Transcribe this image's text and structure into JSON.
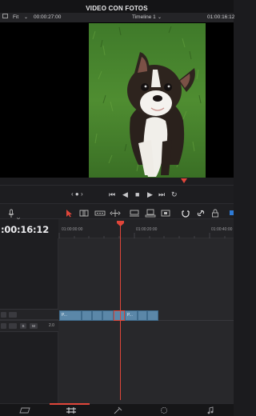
{
  "project": {
    "title": "VIDEO CON FOTOS"
  },
  "viewer": {
    "fit": "Fit",
    "duration": "00:00:27:00",
    "timeline_name": "Timeline 1",
    "source_tc": "01:00:16:12"
  },
  "transport": {
    "prev_next": "‹ ● ›",
    "first": "⏮",
    "reverse": "◀",
    "stop": "■",
    "play": "▶",
    "last": "⏭",
    "loop": "↻"
  },
  "timeline": {
    "timecode": ":00:16:12",
    "ruler": [
      "01:00:00:00",
      "01:00:20:00",
      "01:00:40:00"
    ],
    "video_track": {
      "clip_labels": [
        "P...",
        "P..."
      ]
    },
    "audio_track": {
      "s": "S",
      "m": "M",
      "level": "2.0"
    }
  },
  "bottom_nav": {
    "items": [
      {
        "name": "media",
        "icon": "media-icon"
      },
      {
        "name": "edit",
        "icon": "timeline-edit-icon"
      },
      {
        "name": "fusion",
        "icon": "fusion-icon"
      },
      {
        "name": "color",
        "icon": "color-icon"
      },
      {
        "name": "fairlight",
        "icon": "music-note-icon"
      }
    ],
    "active": "edit"
  },
  "colors": {
    "accent_red": "#e0463a",
    "clip_blue": "#5b87a8",
    "background": "#1b1b1e"
  }
}
